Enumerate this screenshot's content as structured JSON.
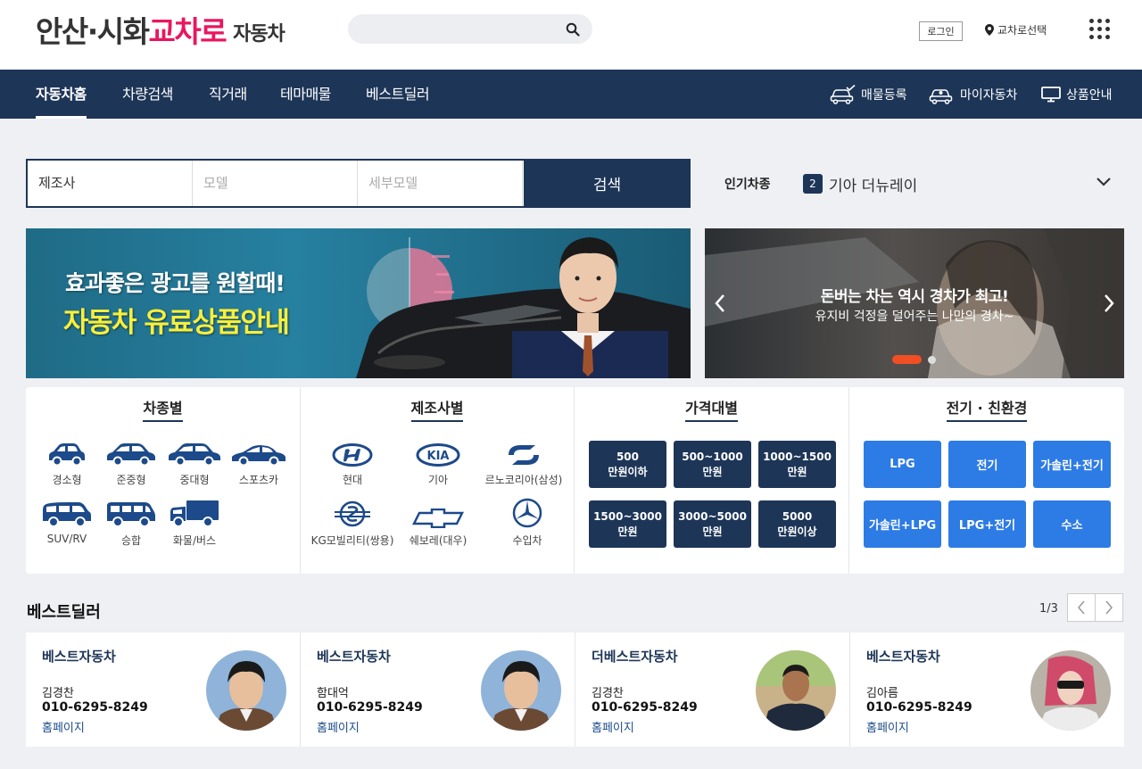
{
  "header": {
    "logo_part1": "안산·시화",
    "logo_part2": "교차로",
    "logo_part3": "자동차",
    "search_placeholder": "",
    "login_label": "로그인",
    "region_label": "교차로선택"
  },
  "nav": {
    "tabs": [
      {
        "label": "자동차홈"
      },
      {
        "label": "차량검색"
      },
      {
        "label": "직거래"
      },
      {
        "label": "테마매물"
      },
      {
        "label": "베스트딜러"
      }
    ],
    "right": [
      {
        "label": "매물등록",
        "icon": "car-check-icon"
      },
      {
        "label": "마이자동차",
        "icon": "car-user-icon"
      },
      {
        "label": "상품안내",
        "icon": "monitor-icon"
      }
    ]
  },
  "filter": {
    "maker": "제조사",
    "model": "모델",
    "submodel": "세부모델",
    "search_label": "검색"
  },
  "popular": {
    "label": "인기차종",
    "rank": "2",
    "car": "기아 더뉴레이"
  },
  "banner_left": {
    "line1": "효과좋은 광고를 원할때!",
    "line2": "자동차 유료상품안내"
  },
  "banner_right": {
    "line1": "돈버는 차는 역시 경차가 최고!",
    "line2": "유지비 걱정을 덜어주는 나만의 경차~"
  },
  "categories": {
    "body_type": {
      "title": "차종별",
      "items": [
        "경소형",
        "준중형",
        "중대형",
        "스포츠카",
        "SUV/RV",
        "승합",
        "화물/버스"
      ]
    },
    "maker": {
      "title": "제조사별",
      "items": [
        "현대",
        "기아",
        "르노코리아(삼성)",
        "KG모빌리티(쌍용)",
        "쉐보레(대우)",
        "수입차"
      ]
    },
    "price": {
      "title": "가격대별",
      "items": [
        {
          "l1": "500",
          "l2": "만원이하"
        },
        {
          "l1": "500~1000",
          "l2": "만원"
        },
        {
          "l1": "1000~1500",
          "l2": "만원"
        },
        {
          "l1": "1500~3000",
          "l2": "만원"
        },
        {
          "l1": "3000~5000",
          "l2": "만원"
        },
        {
          "l1": "5000",
          "l2": "만원이상"
        }
      ]
    },
    "eco": {
      "title": "전기 · 친환경",
      "items": [
        "LPG",
        "전기",
        "가솔린+전기",
        "가솔린+LPG",
        "LPG+전기",
        "수소"
      ]
    }
  },
  "best_dealer": {
    "title": "베스트딜러",
    "page": "1/3",
    "dealers": [
      {
        "company": "베스트자동차",
        "person": "김경찬",
        "phone": "010-6295-8249",
        "homepage": "홈페이지"
      },
      {
        "company": "베스트자동차",
        "person": "함대억",
        "phone": "010-6295-8249",
        "homepage": "홈페이지"
      },
      {
        "company": "더베스트자동차",
        "person": "김경찬",
        "phone": "010-6295-8249",
        "homepage": "홈페이지"
      },
      {
        "company": "베스트자동차",
        "person": "김아름",
        "phone": "010-6295-8249",
        "homepage": "홈페이지"
      }
    ]
  },
  "colors": {
    "navy": "#1d3557",
    "brand_pink": "#e8175d",
    "eco_blue": "#2d7be5",
    "slider_active": "#f04e23"
  }
}
